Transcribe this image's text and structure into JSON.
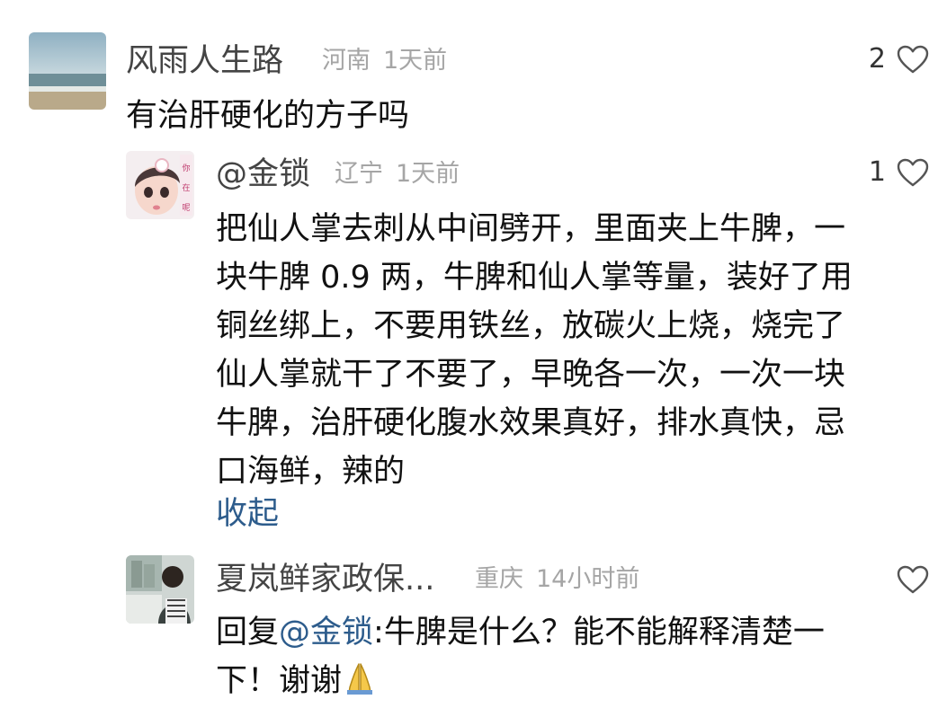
{
  "comments": [
    {
      "username": "风雨人生路",
      "location": "河南",
      "time": "1天前",
      "likes": "2",
      "text": "有治肝硬化的方子吗"
    },
    {
      "username": "@金锁",
      "location": "辽宁",
      "time": "1天前",
      "likes": "1",
      "lines": [
        "把仙人掌去刺从中间劈开，里面夹上牛脾，一",
        "块牛脾 0.9 两，牛脾和仙人掌等量，装好了用",
        "铜丝绑上，不要用铁丝，放碳火上烧，烧完了",
        "仙人掌就干了不要了，早晚各一次，一次一块",
        "牛脾，治肝硬化腹水效果真好，排水真快，忌",
        "口海鲜，辣的"
      ],
      "collapse_label": "收起",
      "avatar_text": "你在呢"
    },
    {
      "username": "夏岚鲜家政保...",
      "location": "重庆",
      "time": "14小时前",
      "likes": "",
      "reply_prefix": "回复",
      "reply_mention": "@金锁",
      "reply_rest": ":牛脾是什么？能不能解释清楚一",
      "reply_line2": "下！谢谢"
    }
  ],
  "colors": {
    "username": "#444444",
    "meta": "#a5a5a5",
    "link": "#2d5c8c"
  },
  "icons": {
    "like": "heart-outline-icon",
    "emoji": "folded-hands-emoji"
  }
}
